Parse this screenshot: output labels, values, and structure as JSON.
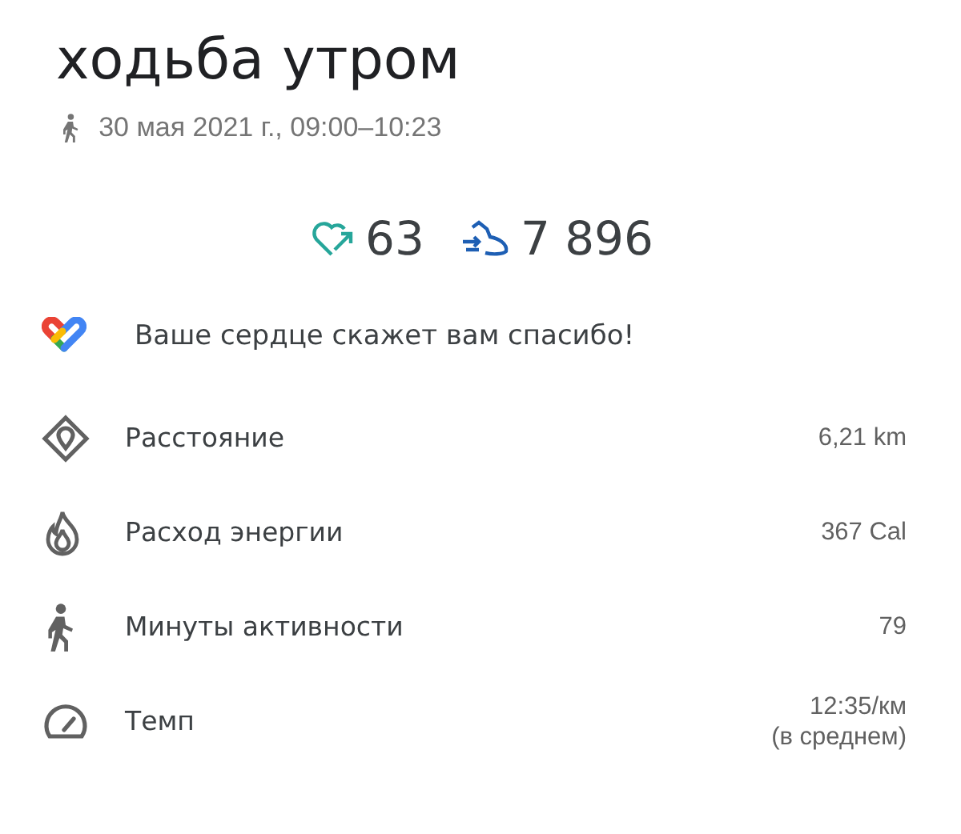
{
  "title": "ходьба утром",
  "subtitle": "30 мая 2021 г., 09:00–10:23",
  "summary": [
    {
      "kind": "heart",
      "value": "63"
    },
    {
      "kind": "steps",
      "value": "7 896"
    }
  ],
  "tip": "Ваше сердце скажет вам спасибо!",
  "metrics": [
    {
      "kind": "distance",
      "label": "Расстояние",
      "value_lines": [
        "6,21 km"
      ]
    },
    {
      "kind": "energy",
      "label": "Расход энергии",
      "value_lines": [
        "367 Cal"
      ]
    },
    {
      "kind": "minutes",
      "label": "Минуты активности",
      "value_lines": [
        "79"
      ]
    },
    {
      "kind": "pace",
      "label": "Темп",
      "value_lines": [
        "12:35/км",
        "(в среднем)"
      ]
    }
  ]
}
